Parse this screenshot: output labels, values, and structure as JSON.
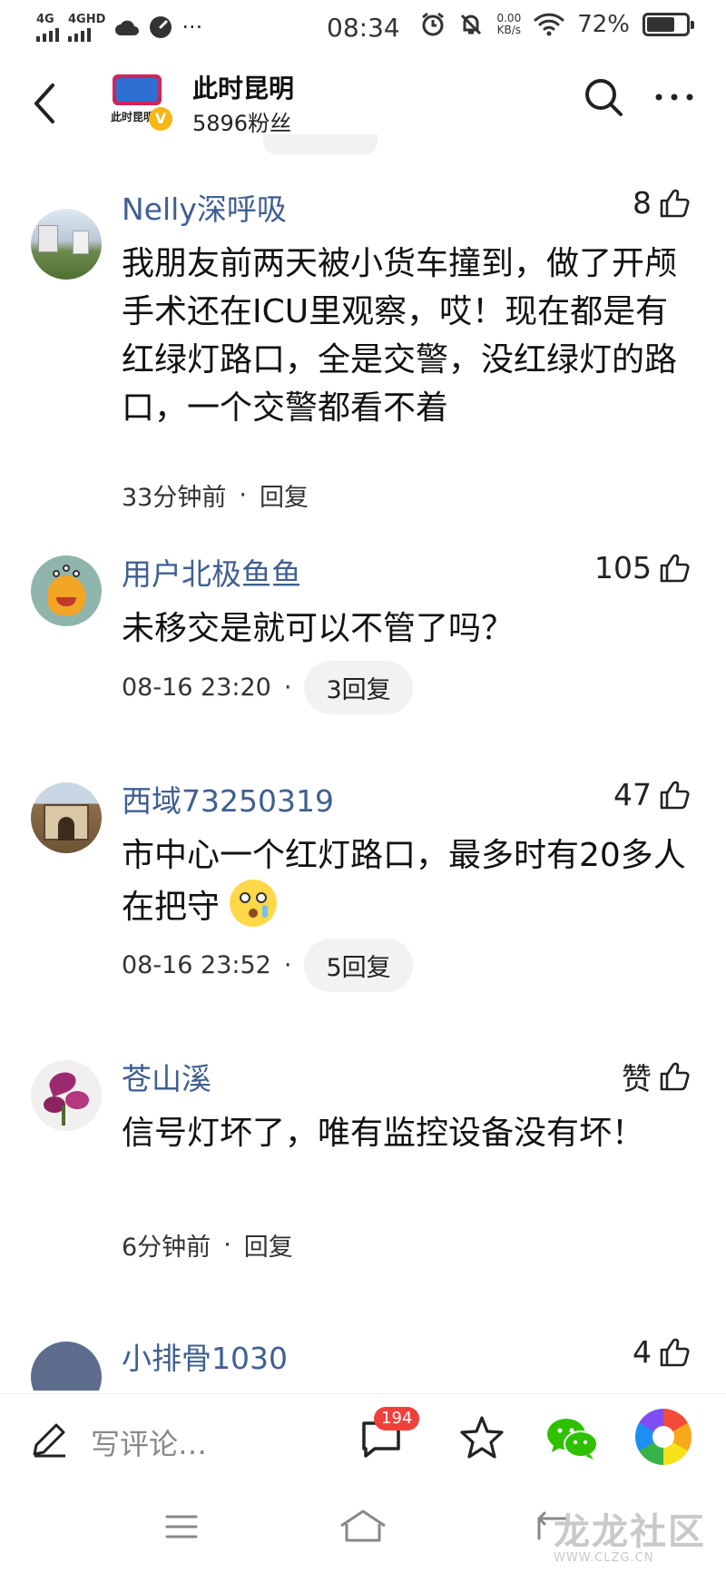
{
  "status_bar": {
    "sim1": "4G",
    "sim2": "4GHD",
    "more_indicator": "···",
    "time": "08:34",
    "net_speed_value": "0.00",
    "net_speed_unit": "KB/s",
    "battery": "72%",
    "battery_level": 0.72
  },
  "header": {
    "account_name": "此时昆明",
    "fans": "5896粉丝",
    "logo_text": "此时昆明",
    "verified_badge": "V"
  },
  "comments": [
    {
      "user": "Nelly深呼吸",
      "likes": "8",
      "text": "我朋友前两天被小货车撞到，做了开颅手术还在ICU里观察，哎！现在都是有红绿灯路口，全是交警，没红绿灯的路口，一个交警都看不着",
      "time": "33分钟前",
      "reply": "回复"
    },
    {
      "user": "用户北极鱼鱼",
      "likes": "105",
      "text": "未移交是就可以不管了吗？",
      "time": "08-16 23:20",
      "reply": "3回复"
    },
    {
      "user": "西域73250319",
      "likes": "47",
      "text": "市中心一个红灯路口，最多时有20多人在把守",
      "time": "08-16 23:52",
      "reply": "5回复"
    },
    {
      "user": "苍山溪",
      "likes": "赞",
      "text": "信号灯坏了，唯有监控设备没有坏！",
      "time": "6分钟前",
      "reply": "回复"
    },
    {
      "user": "小排骨1030",
      "likes": "4"
    }
  ],
  "separator": "·",
  "bottom_bar": {
    "placeholder": "写评论…",
    "comment_count": "194"
  },
  "watermark": {
    "text": "龙龙社区",
    "site": "WWW.CLZG.CN"
  },
  "icons": {
    "back": "back-arrow-icon",
    "search": "search-icon",
    "more": "more-icon",
    "like": "thumbs-up-icon",
    "pencil": "pencil-icon",
    "comment": "comment-icon",
    "star": "star-icon",
    "wechat": "wechat-icon",
    "moments": "moments-icon"
  },
  "colors": {
    "username": "#3f5f92",
    "badge": "#f0403b",
    "wechat": "#2dc100"
  }
}
